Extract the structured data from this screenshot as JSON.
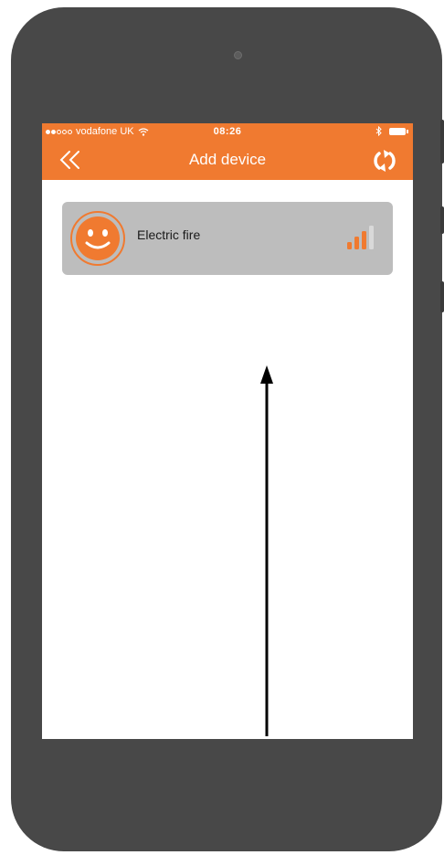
{
  "status_bar": {
    "carrier": "vodafone UK",
    "time": "08:26",
    "icons": [
      "signal-dots-icon",
      "wifi-icon",
      "bluetooth-icon",
      "battery-icon"
    ]
  },
  "nav_bar": {
    "title": "Add device",
    "back_icon": "double-chevron-left-icon",
    "refresh_icon": "refresh-icon"
  },
  "devices": [
    {
      "name": "Electric fire",
      "icon": "smiley-face-icon",
      "signal_icon": "signal-strength-icon",
      "signal_level_bars": 3,
      "signal_max_bars": 4
    }
  ],
  "colors": {
    "accent": "#f07a30",
    "phone_body": "#484848",
    "card_background": "#bdbdbd"
  }
}
